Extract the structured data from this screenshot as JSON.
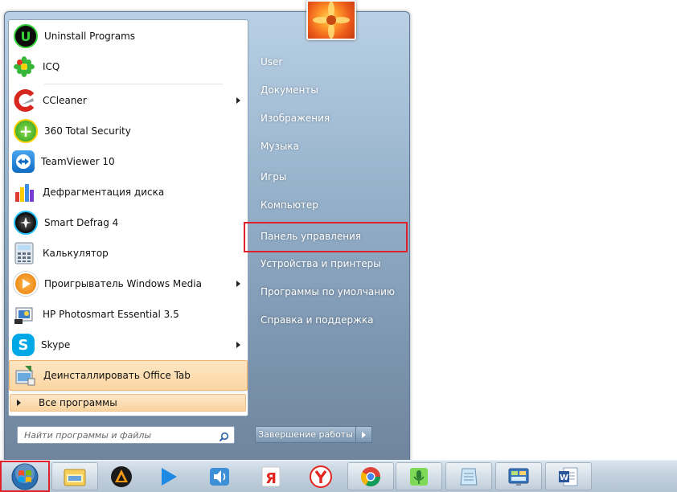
{
  "start_menu": {
    "programs": [
      {
        "label": "Uninstall Programs",
        "icon": "uninstall-programs-icon",
        "arrow": false
      },
      {
        "label": "ICQ",
        "icon": "icq-icon",
        "arrow": false
      },
      {
        "label": "CCleaner",
        "icon": "ccleaner-icon",
        "arrow": true
      },
      {
        "label": "360 Total Security",
        "icon": "360-total-security-icon",
        "arrow": false
      },
      {
        "label": "TeamViewer 10",
        "icon": "teamviewer-icon",
        "arrow": false
      },
      {
        "label": "Дефрагментация диска",
        "icon": "disk-defrag-icon",
        "arrow": false
      },
      {
        "label": "Smart Defrag 4",
        "icon": "smart-defrag-icon",
        "arrow": false
      },
      {
        "label": "Калькулятор",
        "icon": "calculator-icon",
        "arrow": false
      },
      {
        "label": "Проигрыватель Windows Media",
        "icon": "windows-media-player-icon",
        "arrow": true
      },
      {
        "label": "HP Photosmart Essential 3.5",
        "icon": "hp-photosmart-icon",
        "arrow": false
      },
      {
        "label": "Skype",
        "icon": "skype-icon",
        "arrow": true
      },
      {
        "label": "Деинсталлировать Office Tab",
        "icon": "office-tab-uninstall-icon",
        "arrow": false
      }
    ],
    "all_programs_label": "Все программы",
    "search_placeholder": "Найти программы и файлы",
    "right_items": [
      "User",
      "Документы",
      "Изображения",
      "Музыка",
      "Игры",
      "Компьютер",
      "Панель управления",
      "Устройства и принтеры",
      "Программы по умолчанию",
      "Справка и поддержка"
    ],
    "shutdown_label": "Завершение работы",
    "highlighted_right_item": "Панель управления"
  },
  "taskbar": {
    "items": [
      "windows-start-orb-icon",
      "file-explorer-icon",
      "aimp-icon",
      "media-play-icon",
      "audio-speaker-icon",
      "yandex-icon",
      "yandex-browser-icon",
      "chrome-icon",
      "microphone-icon",
      "notepad-icon",
      "control-panel-icon",
      "word-icon"
    ]
  },
  "colors": {
    "highlight_red": "#e0212b",
    "hover_orange": "#fbd6a3",
    "menu_blue": "#7f98b3"
  }
}
